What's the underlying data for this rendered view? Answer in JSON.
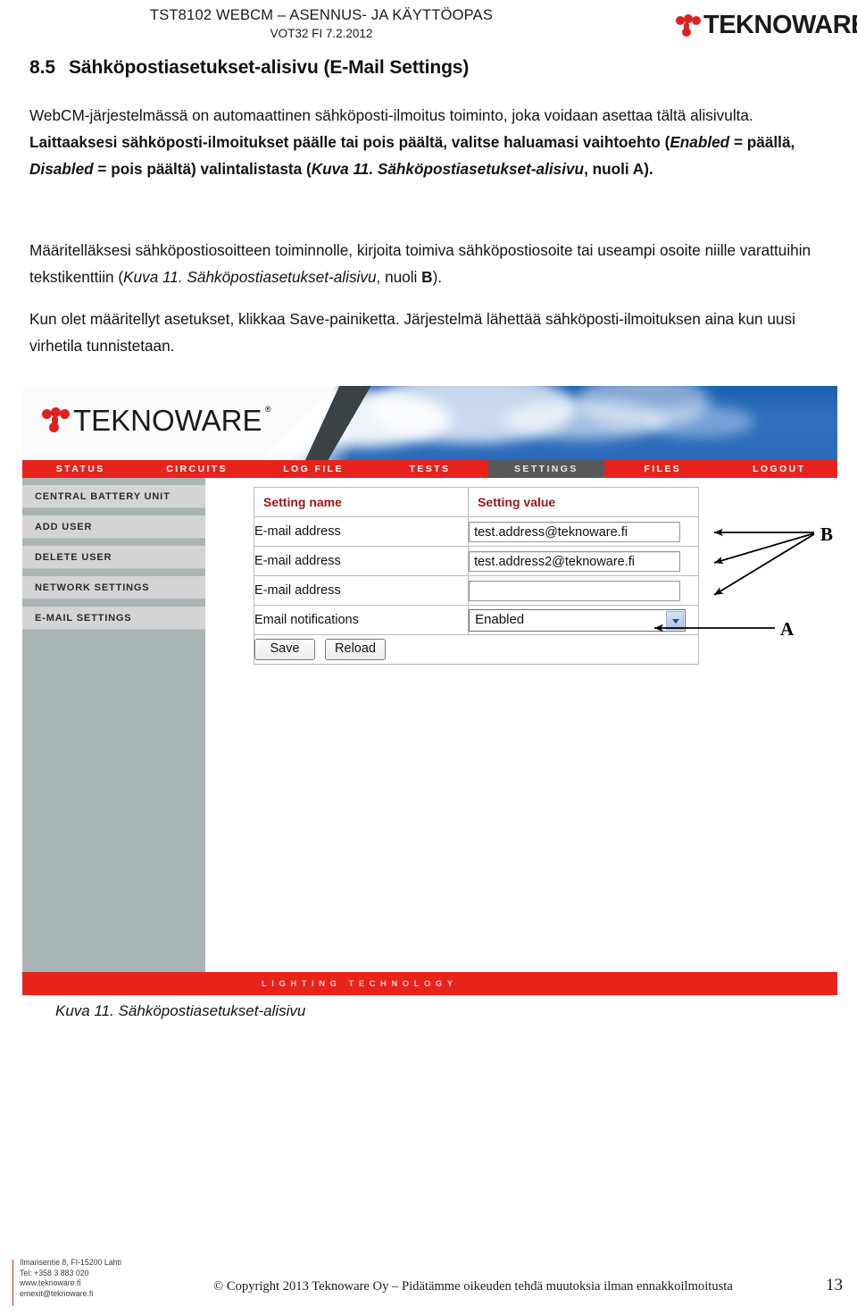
{
  "document_header": {
    "line1": "TST8102 WEBCM – ASENNUS- JA KÄYTTÖOPAS",
    "line2": "VOT32 FI 7.2.2012",
    "logo_word": "TEKNOWARE",
    "logo_reg": "®"
  },
  "section": {
    "number": "8.5",
    "title": "Sähköpostiasetukset-alisivu (E-Mail Settings)"
  },
  "paragraphs": {
    "p1_a": "WebCM-järjestelmässä on automaattinen sähköposti-ilmoitus toiminto, joka voidaan asettaa tältä alisivulta. ",
    "p1_b": "Laittaaksesi sähköposti-ilmoitukset päälle tai pois päältä, valitse haluamasi vaihtoehto (",
    "p1_enabled": "Enabled",
    "p1_c": " = päällä, ",
    "p1_disabled": "Disabled",
    "p1_d": " = pois päältä) valintalistasta (",
    "p1_ref": "Kuva 11. Sähköpostiasetukset-alisivu",
    "p1_e": ", nuoli ",
    "p1_arrow": "A",
    "p1_f": ").",
    "p2_a": "Määritelläksesi sähköpostiosoitteen toiminnolle, kirjoita toimiva sähköpostiosoite tai useampi osoite niille varattuihin tekstikenttiin (",
    "p2_ref": "Kuva 11. Sähköpostiasetukset-alisivu",
    "p2_b": ", nuoli ",
    "p2_arrow": "B",
    "p2_c": ").",
    "p3": "Kun olet määritellyt asetukset, klikkaa Save-painiketta. Järjestelmä lähettää sähköposti-ilmoituksen aina kun uusi virhetila tunnistetaan."
  },
  "screenshot": {
    "logo_word": "TEKNOWARE",
    "logo_reg": "®",
    "nav": [
      {
        "label": "STATUS",
        "active": false
      },
      {
        "label": "CIRCUITS",
        "active": false
      },
      {
        "label": "LOG FILE",
        "active": false
      },
      {
        "label": "TESTS",
        "active": false
      },
      {
        "label": "SETTINGS",
        "active": true
      },
      {
        "label": "FILES",
        "active": false
      },
      {
        "label": "LOGOUT",
        "active": false
      }
    ],
    "sidebar": [
      {
        "label": "CENTRAL BATTERY UNIT"
      },
      {
        "label": "ADD USER"
      },
      {
        "label": "DELETE USER"
      },
      {
        "label": "NETWORK SETTINGS"
      },
      {
        "label": "E-MAIL SETTINGS"
      }
    ],
    "table": {
      "header_name": "Setting name",
      "header_value": "Setting value",
      "rows": [
        {
          "name": "E-mail address",
          "value": "test.address@teknoware.fi",
          "type": "text"
        },
        {
          "name": "E-mail address",
          "value": "test.address2@teknoware.fi",
          "type": "text"
        },
        {
          "name": "E-mail address",
          "value": "",
          "type": "text"
        },
        {
          "name": "Email notifications",
          "value": "Enabled",
          "type": "select"
        }
      ],
      "save_label": "Save",
      "reload_label": "Reload"
    },
    "footer_text": "LIGHTING TECHNOLOGY",
    "colors": {
      "brand_red": "#e8231c",
      "nav_active": "#58585a",
      "sidebar_bg": "#a9b5b5",
      "sidebar_item": "#d4d4d4",
      "header_red_text": "#9b1616"
    }
  },
  "annotations": {
    "label_a": "A",
    "label_b": "B"
  },
  "figure_caption": "Kuva 11.  Sähköpostiasetukset-alisivu",
  "page_footer": {
    "contact_line1": "Ilmarisentie 8, FI-15200 Lahti",
    "contact_line2": "Tel: +358 3 883 020",
    "contact_line3": "www.teknoware.fi",
    "contact_line4": "emexit@teknoware.fi",
    "copyright": "© Copyright 2013 Teknoware Oy – Pidätämme oikeuden tehdä muutoksia ilman ennakkoilmoitusta",
    "page_number": "13"
  }
}
